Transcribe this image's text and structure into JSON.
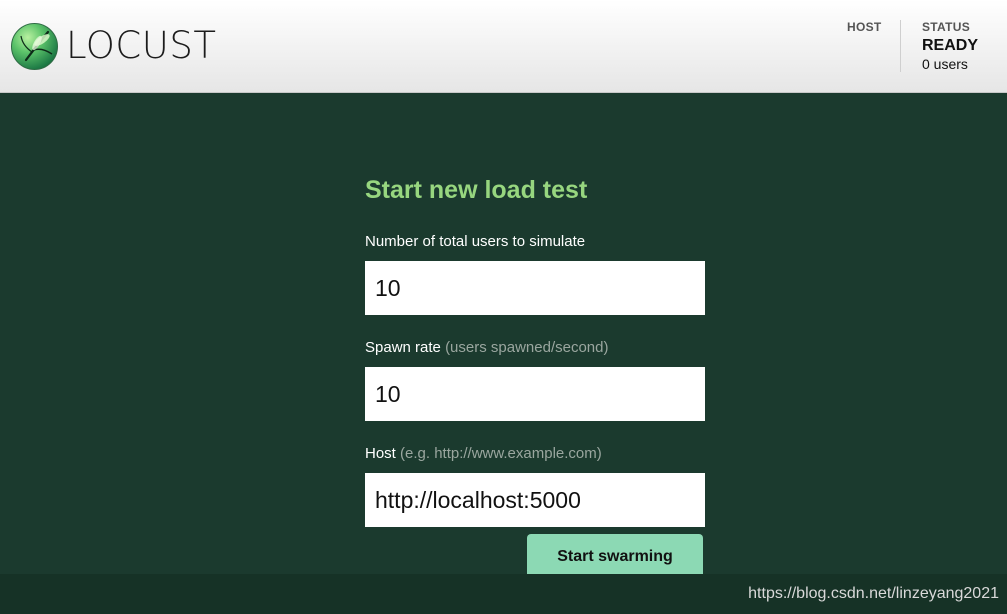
{
  "header": {
    "logo_text": "LOCUST",
    "host_label": "HOST",
    "status_label": "STATUS",
    "status_value": "READY",
    "status_users": "0 users"
  },
  "form": {
    "title": "Start new load test",
    "users": {
      "label": "Number of total users to simulate",
      "value": "10"
    },
    "spawn_rate": {
      "label": "Spawn rate",
      "hint": "(users spawned/second)",
      "value": "10"
    },
    "host": {
      "label": "Host",
      "hint": "(e.g. http://www.example.com)",
      "value": "http://localhost:5000"
    },
    "submit_label": "Start swarming"
  },
  "watermark": "https://blog.csdn.net/linzeyang2021",
  "colors": {
    "background": "#1b3a2e",
    "title_green": "#97d67f",
    "button_green": "#8cd9b4"
  }
}
